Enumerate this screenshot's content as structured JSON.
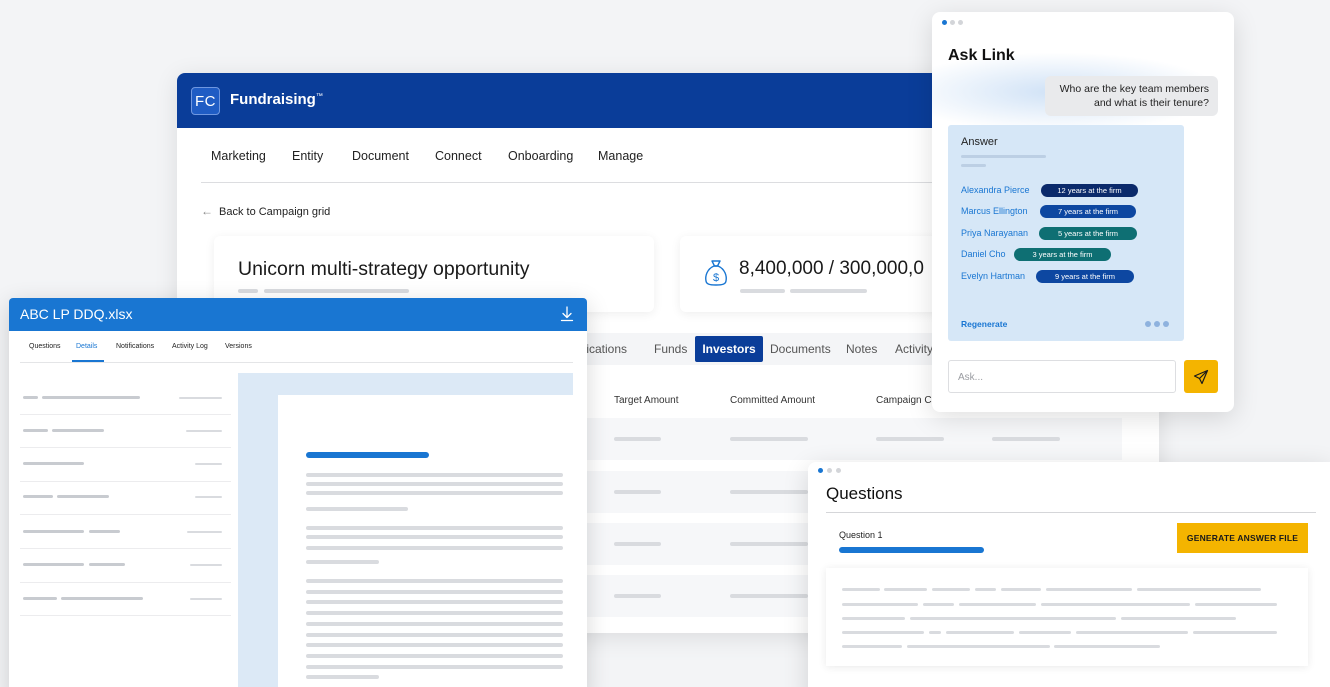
{
  "fundraising": {
    "logo_text": "FC",
    "app_title": "Fundraising",
    "trademark": "™",
    "nav": [
      "Marketing",
      "Entity",
      "Document",
      "Connect",
      "Onboarding",
      "Manage"
    ],
    "back_link": "Back to Campaign grid",
    "campaign_title": "Unicorn multi-strategy opportunity",
    "amount": "8,400,000 / 300,000,0",
    "tabs": [
      "tifications",
      "Funds",
      "Investors",
      "Documents",
      "Notes",
      "Activity"
    ],
    "active_tab": "Investors",
    "columns": [
      "Target Amount",
      "Committed Amount",
      "Campaign Cu"
    ]
  },
  "ddq": {
    "title": "ABC LP DDQ.xlsx",
    "tabs": [
      "Questions",
      "Details",
      "Notifications",
      "Activity Log",
      "Versions"
    ],
    "active_tab": "Details"
  },
  "ask_link": {
    "title": "Ask Link",
    "question": "Who are the key team members and what is their tenure?",
    "answer_label": "Answer",
    "members": [
      {
        "name": "Alexandra Pierce",
        "tenure": "12 years at the firm",
        "color": "#0b2a6b"
      },
      {
        "name": "Marcus Ellington",
        "tenure": "7 years at the firm",
        "color": "#0d47a1"
      },
      {
        "name": "Priya Narayanan",
        "tenure": "5 years at the firm",
        "color": "#0e6f73"
      },
      {
        "name": "Daniel Cho",
        "tenure": "3 years at the firm",
        "color": "#0e6f73"
      },
      {
        "name": "Evelyn Hartman",
        "tenure": "9 years at the firm",
        "color": "#0d47a1"
      }
    ],
    "regenerate": "Regenerate",
    "input_placeholder": "Ask..."
  },
  "questions": {
    "title": "Questions",
    "question_label": "Question 1",
    "generate_button": "GENERATE ANSWER FILE"
  },
  "colors": {
    "brand_navy": "#0a3d99",
    "brand_blue": "#1976d2",
    "accent_yellow": "#f4b400"
  },
  "icons": [
    "money-bag-icon",
    "download-icon",
    "send-icon",
    "back-arrow-icon",
    "more-dots-icon"
  ]
}
